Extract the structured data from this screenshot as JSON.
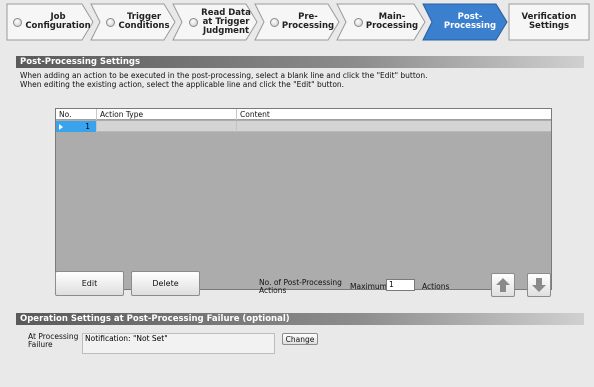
{
  "tabs": [
    {
      "label": "Job\nConfiguration",
      "active": false
    },
    {
      "label": "Trigger\nConditions",
      "active": false
    },
    {
      "label": "Read Data\nat Trigger\nJudgment",
      "active": false
    },
    {
      "label": "Pre-\nProcessing",
      "active": false
    },
    {
      "label": "Main-\nProcessing",
      "active": false
    },
    {
      "label": "Post-\nProcessing",
      "active": true
    },
    {
      "label": "Verification\nSettings",
      "active": false
    }
  ],
  "post_processing": {
    "title": "Post-Processing Settings",
    "desc_line1": "When adding an action to be executed in the post-processing, select a blank line and click the \"Edit\" button.",
    "desc_line2": "When editing the existing action, select the applicable line and click the \"Edit\" button.",
    "table": {
      "columns": [
        "No.",
        "Action Type",
        "Content"
      ],
      "rows": [
        {
          "no": "1",
          "action_type": "",
          "content": ""
        }
      ]
    },
    "edit_label": "Edit",
    "delete_label": "Delete",
    "count_label": "No. of Post-Processing\nActions",
    "maximum_label": "Maximum",
    "maximum_value": "1",
    "actions_unit": "Actions"
  },
  "failure": {
    "title": "Operation Settings at Post-Processing Failure (optional)",
    "at_failure_label": "At Processing\nFailure",
    "notification_value": "Notification: \"Not Set\"",
    "change_label": "Change"
  },
  "icons": {
    "move_up": "arrow-up-icon",
    "move_down": "arrow-down-icon"
  },
  "colors": {
    "active_tab": "#3b7fcf",
    "section_bar": "#5a5a5a",
    "selected_cell": "#3aa3ee"
  }
}
